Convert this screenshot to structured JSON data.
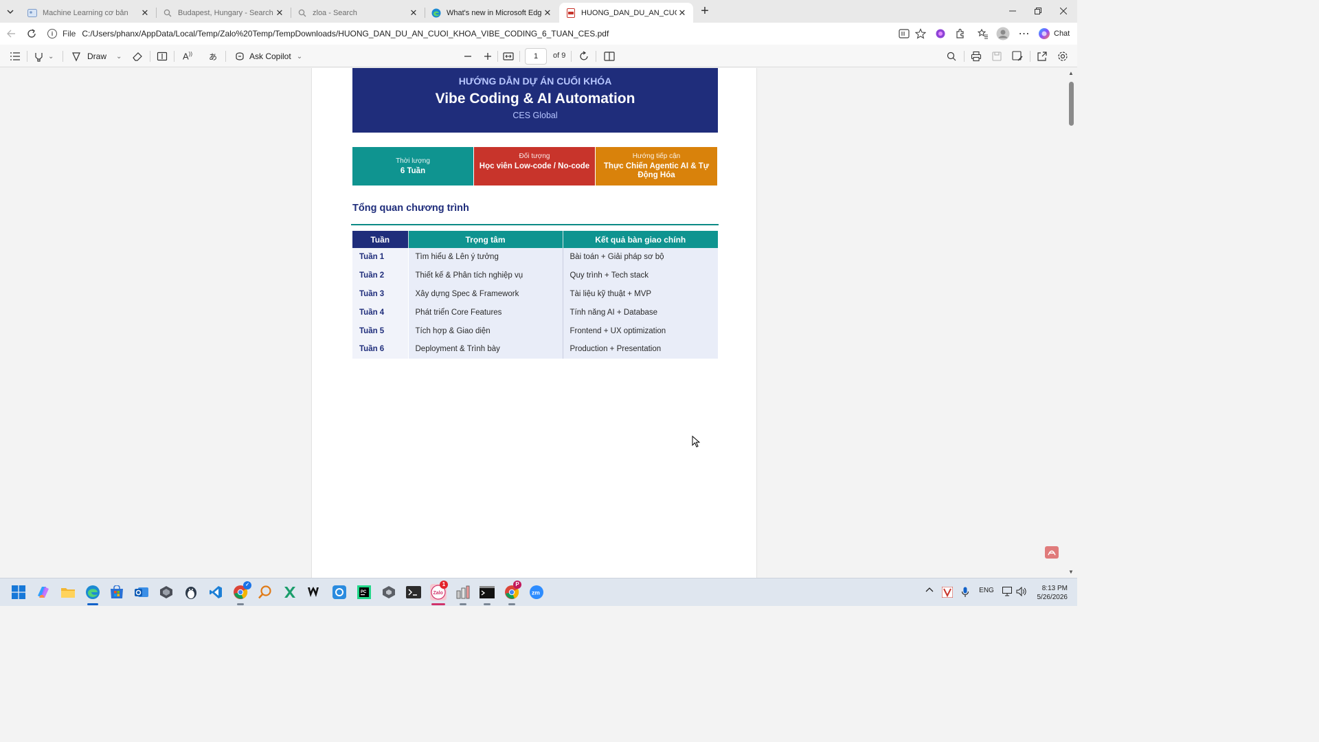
{
  "browser": {
    "tabs": [
      {
        "title": "Machine Learning cơ bản",
        "icon": "ml-site-icon"
      },
      {
        "title": "Budapest, Hungary - Search",
        "icon": "search-icon"
      },
      {
        "title": "zloa - Search",
        "icon": "search-icon"
      },
      {
        "title": "What's new in Microsoft Edge",
        "icon": "edge-icon"
      },
      {
        "title": "HUONG_DAN_DU_AN_CUOI_KHO...",
        "icon": "pdf-icon",
        "active": true
      }
    ],
    "address": {
      "scheme_label": "File",
      "url": "C:/Users/phanx/AppData/Local/Temp/Zalo%20Temp/TempDownloads/HUONG_DAN_DU_AN_CUOI_KHOA_VIBE_CODING_6_TUAN_CES.pdf"
    },
    "chat_label": "Chat"
  },
  "pdf_toolbar": {
    "draw_label": "Draw",
    "copilot_label": "Ask Copilot",
    "page_current": "1",
    "page_total_label": "of 9"
  },
  "document": {
    "hero": {
      "kicker": "HƯỚNG DẪN DỰ ÁN CUỐI KHÓA",
      "title": "Vibe Coding & AI Automation",
      "subtitle": "CES Global"
    },
    "cards": [
      {
        "label": "Thời lượng",
        "value": "6 Tuần",
        "color": "#0f9490"
      },
      {
        "label": "Đối tượng",
        "value": "Học viên Low-code / No-code",
        "color": "#c8342b"
      },
      {
        "label": "Hướng tiếp cận",
        "value": "Thực Chiến Agentic AI & Tự Động Hóa",
        "color": "#d9820b"
      }
    ],
    "section_title": "Tổng quan chương trình",
    "table": {
      "headers": [
        "Tuần",
        "Trọng tâm",
        "Kết quả bàn giao chính"
      ],
      "rows": [
        [
          "Tuần 1",
          "Tìm hiểu & Lên ý tưởng",
          "Bài toán + Giải pháp sơ bộ"
        ],
        [
          "Tuần 2",
          "Thiết kế & Phân tích nghiệp vụ",
          "Quy trình + Tech stack"
        ],
        [
          "Tuần 3",
          "Xây dựng Spec & Framework",
          "Tài liệu kỹ thuật + MVP"
        ],
        [
          "Tuần 4",
          "Phát triển Core Features",
          "Tính năng AI + Database"
        ],
        [
          "Tuần 5",
          "Tích hợp & Giao diện",
          "Frontend + UX optimization"
        ],
        [
          "Tuần 6",
          "Deployment & Trình bày",
          "Production + Presentation"
        ]
      ]
    }
  },
  "taskbar": {
    "zalo_badge": "1",
    "chrome_badge": "P",
    "language": "ENG",
    "time": "8:13 PM",
    "date": "5/26/2026"
  }
}
